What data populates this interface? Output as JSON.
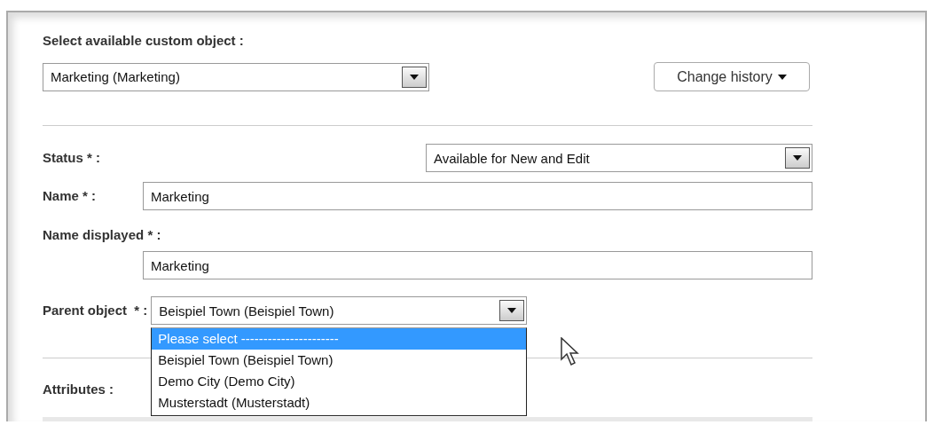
{
  "custom_object": {
    "label": "Select available custom object :",
    "value": "Marketing (Marketing)"
  },
  "change_history": {
    "label": "Change history"
  },
  "fields": [
    {
      "kind": "select",
      "label": "Status * :",
      "value": "Available for New and Edit"
    },
    {
      "kind": "text",
      "label": "Name * :",
      "value": "Marketing"
    },
    {
      "kind": "text-below",
      "label": "Name displayed * :",
      "value": "Marketing"
    },
    {
      "kind": "select-open",
      "label": "Parent object  * :",
      "value": "Beispiel Town (Beispiel Town)",
      "options": [
        {
          "label": "Please select ----------------------",
          "highlighted": true
        },
        {
          "label": "Beispiel Town (Beispiel Town)",
          "highlighted": false
        },
        {
          "label": "Demo City (Demo City)",
          "highlighted": false
        },
        {
          "label": "Musterstadt (Musterstadt)",
          "highlighted": false
        }
      ]
    }
  ],
  "attributes_label": "Attributes :"
}
